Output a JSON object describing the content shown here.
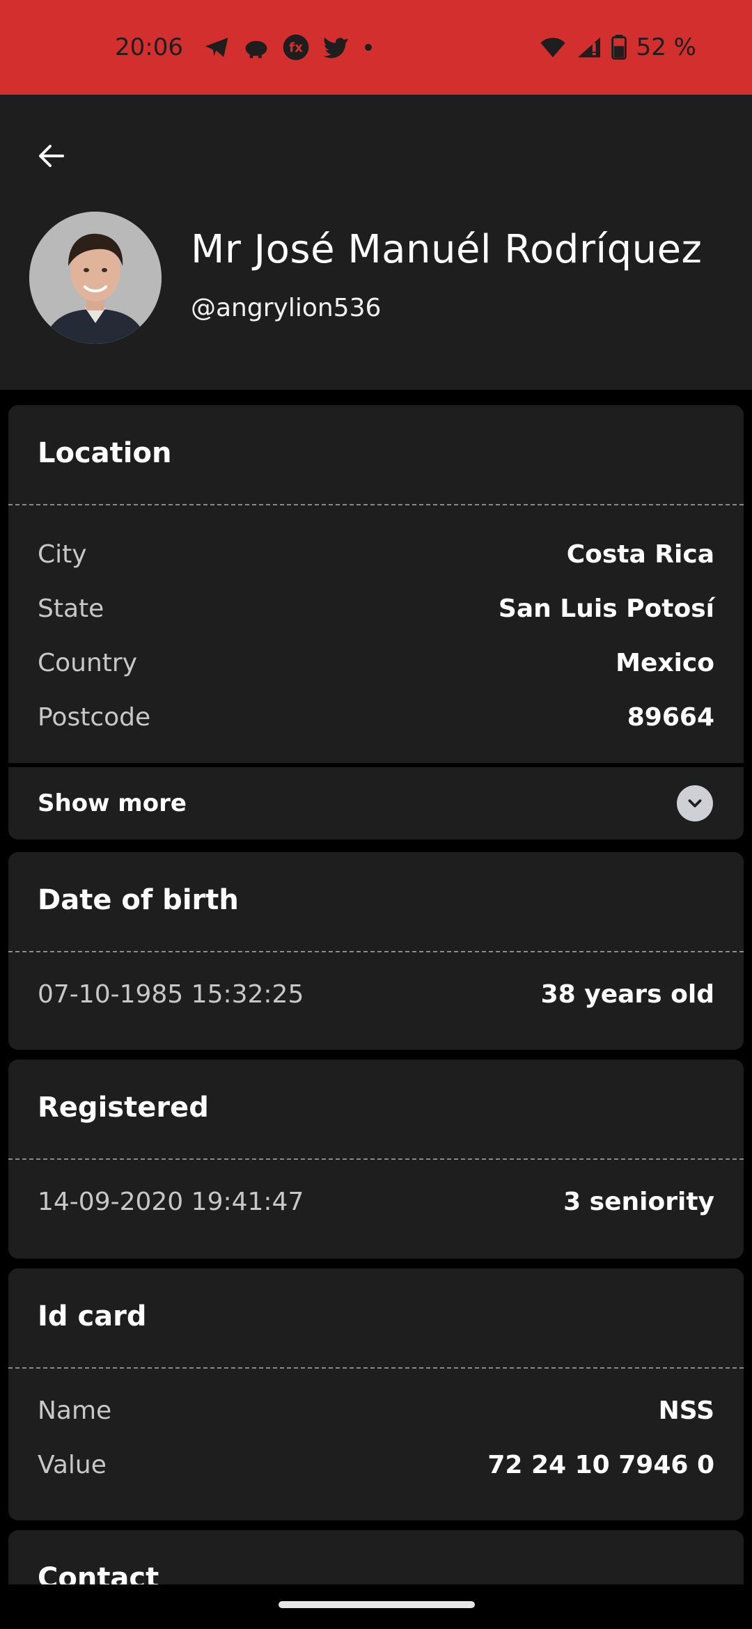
{
  "status_bar": {
    "time": "20:06",
    "battery": "52 %",
    "left_icons": [
      "telegram-icon",
      "piggy-bank-icon",
      "fx-app-icon",
      "twitter-icon",
      "dot-icon"
    ],
    "right_icons": [
      "wifi-icon",
      "cell-signal-icon",
      "battery-icon"
    ]
  },
  "profile": {
    "name": "Mr José Manuél Rodríquez",
    "username": "@angrylion536"
  },
  "location": {
    "title": "Location",
    "rows": [
      {
        "label": "City",
        "value": "Costa Rica"
      },
      {
        "label": "State",
        "value": "San Luis Potosí"
      },
      {
        "label": "Country",
        "value": "Mexico"
      },
      {
        "label": "Postcode",
        "value": "89664"
      }
    ],
    "show_more": "Show more"
  },
  "dob": {
    "title": "Date of birth",
    "date": "07-10-1985 15:32:25",
    "age": "38 years old"
  },
  "registered": {
    "title": "Registered",
    "date": "14-09-2020 19:41:47",
    "seniority": "3 seniority"
  },
  "id_card": {
    "title": "Id card",
    "rows": [
      {
        "label": "Name",
        "value": "NSS"
      },
      {
        "label": "Value",
        "value": "72 24 10 7946 0"
      }
    ]
  },
  "contact": {
    "title": "Contact"
  },
  "colors": {
    "status_bar": "#d32f2f",
    "background": "#000000",
    "card": "#1e1e1e",
    "text_primary": "#ffffff",
    "text_secondary": "#c8c8c8"
  }
}
